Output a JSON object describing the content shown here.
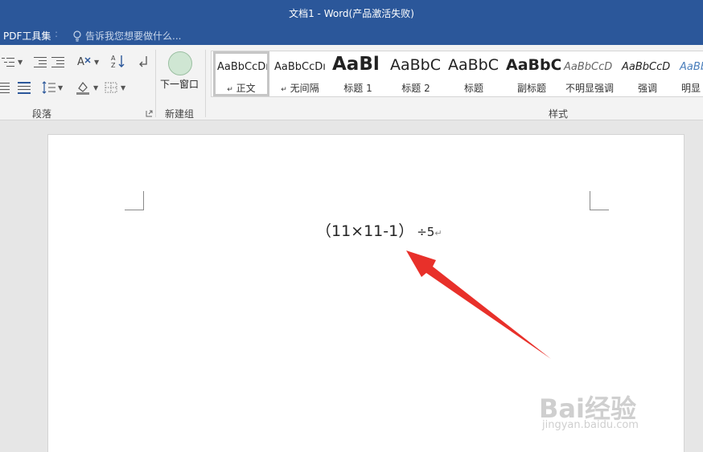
{
  "window": {
    "title": "文档1 - Word(产品激活失败)"
  },
  "tellbar": {
    "pdf_tools": "PDF工具集",
    "tell_me_placeholder": "告诉我您想要做什么..."
  },
  "ribbon": {
    "groups": {
      "paragraph": "段落",
      "new_group": "新建组",
      "styles": "样式"
    },
    "new_group": {
      "next_window": "下一窗口"
    },
    "styles": [
      {
        "preview": "AaBbCcDı",
        "name": "正文",
        "marker": "↵"
      },
      {
        "preview": "AaBbCcDı",
        "name": "无间隔",
        "marker": "↵"
      },
      {
        "preview": "AaBl",
        "name": "标题 1"
      },
      {
        "preview": "AaBbC",
        "name": "标题 2"
      },
      {
        "preview": "AaBbC",
        "name": "标题"
      },
      {
        "preview": "AaBbC",
        "name": "副标题"
      },
      {
        "preview": "AaBbCcD",
        "name": "不明显强调"
      },
      {
        "preview": "AaBbCcD",
        "name": "强调"
      },
      {
        "preview": "AaBb",
        "name": "明显"
      }
    ]
  },
  "document": {
    "expression": "（11×11-1）",
    "operator": "÷5",
    "paragraph_mark": "↵"
  },
  "watermark": {
    "brand": "Bai经验",
    "url": "jingyan.baidu.com"
  },
  "colors": {
    "title_bar": "#2b579a",
    "arrow": "#e8302a",
    "ribbon": "#f3f3f3",
    "canvas": "#e6e6e6"
  }
}
